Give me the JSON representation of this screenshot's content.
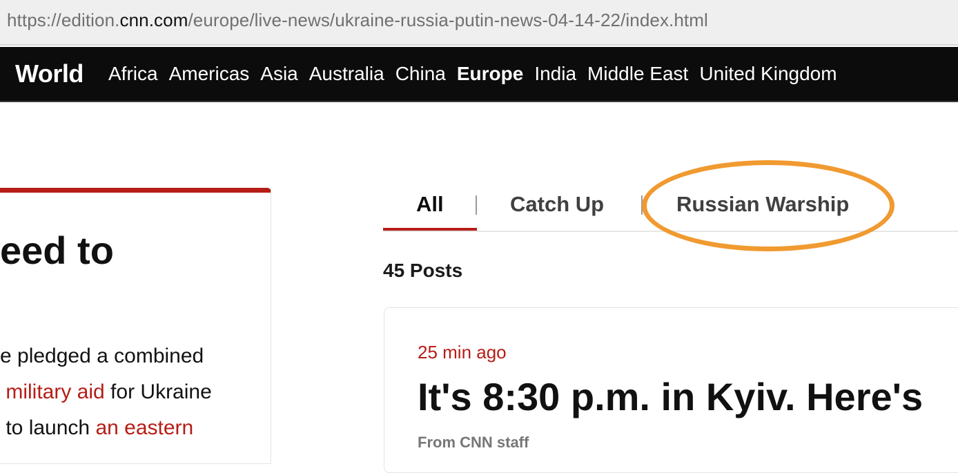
{
  "browser": {
    "url_prefix": "https://edition.",
    "url_host": "cnn.com",
    "url_path": "/europe/live-news/ukraine-russia-putin-news-04-14-22/index.html"
  },
  "nav": {
    "brand": "World",
    "links": [
      "Africa",
      "Americas",
      "Asia",
      "Australia",
      "China",
      "Europe",
      "India",
      "Middle East",
      "United Kingdom"
    ],
    "active": "Europe"
  },
  "left_article": {
    "headline": "eed to",
    "body_line1": "e pledged a combined",
    "body_line2_link": "military aid",
    "body_line2_rest": " for Ukraine",
    "body_line3_pre": "to launch ",
    "body_line3_link": "an eastern"
  },
  "tabs": {
    "items": [
      "All",
      "Catch Up",
      "Russian Warship"
    ],
    "active": "All",
    "highlight_color": "#f09a30"
  },
  "posts": {
    "count_label": "45 Posts"
  },
  "post": {
    "time": "25 min ago",
    "title": "It's 8:30 p.m. in Kyiv. Here's",
    "byline": "From CNN staff"
  },
  "colors": {
    "accent_red": "#b51d16",
    "nav_bg": "#0c0c0c"
  }
}
